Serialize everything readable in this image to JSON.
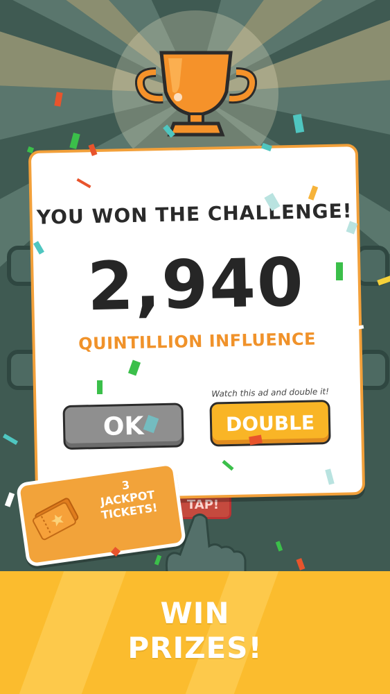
{
  "popup": {
    "headline": "YOU WON THE CHALLENGE!",
    "score": "2,940",
    "unit": "QUINTILLION INFLUENCE",
    "ad_hint": "Watch this ad and double it!"
  },
  "buttons": {
    "ok_label": "OK",
    "double_label": "DOUBLE"
  },
  "ticket_badge": {
    "count": "3",
    "line1": "JACKPOT",
    "line2": "TICKETS!"
  },
  "background": {
    "tap_label": "TAP!"
  },
  "promo_banner": {
    "line1": "WIN",
    "line2": "PRIZES!"
  },
  "colors": {
    "background": "#3f5a52",
    "card_border": "#f2a03a",
    "accent_orange": "#f0922a",
    "double_button": "#f9b526",
    "ok_button": "#8f8f8f",
    "banner": "#fbbc2e"
  },
  "icons": [
    "trophy-icon",
    "ticket-icon",
    "pointing-hand-icon"
  ]
}
